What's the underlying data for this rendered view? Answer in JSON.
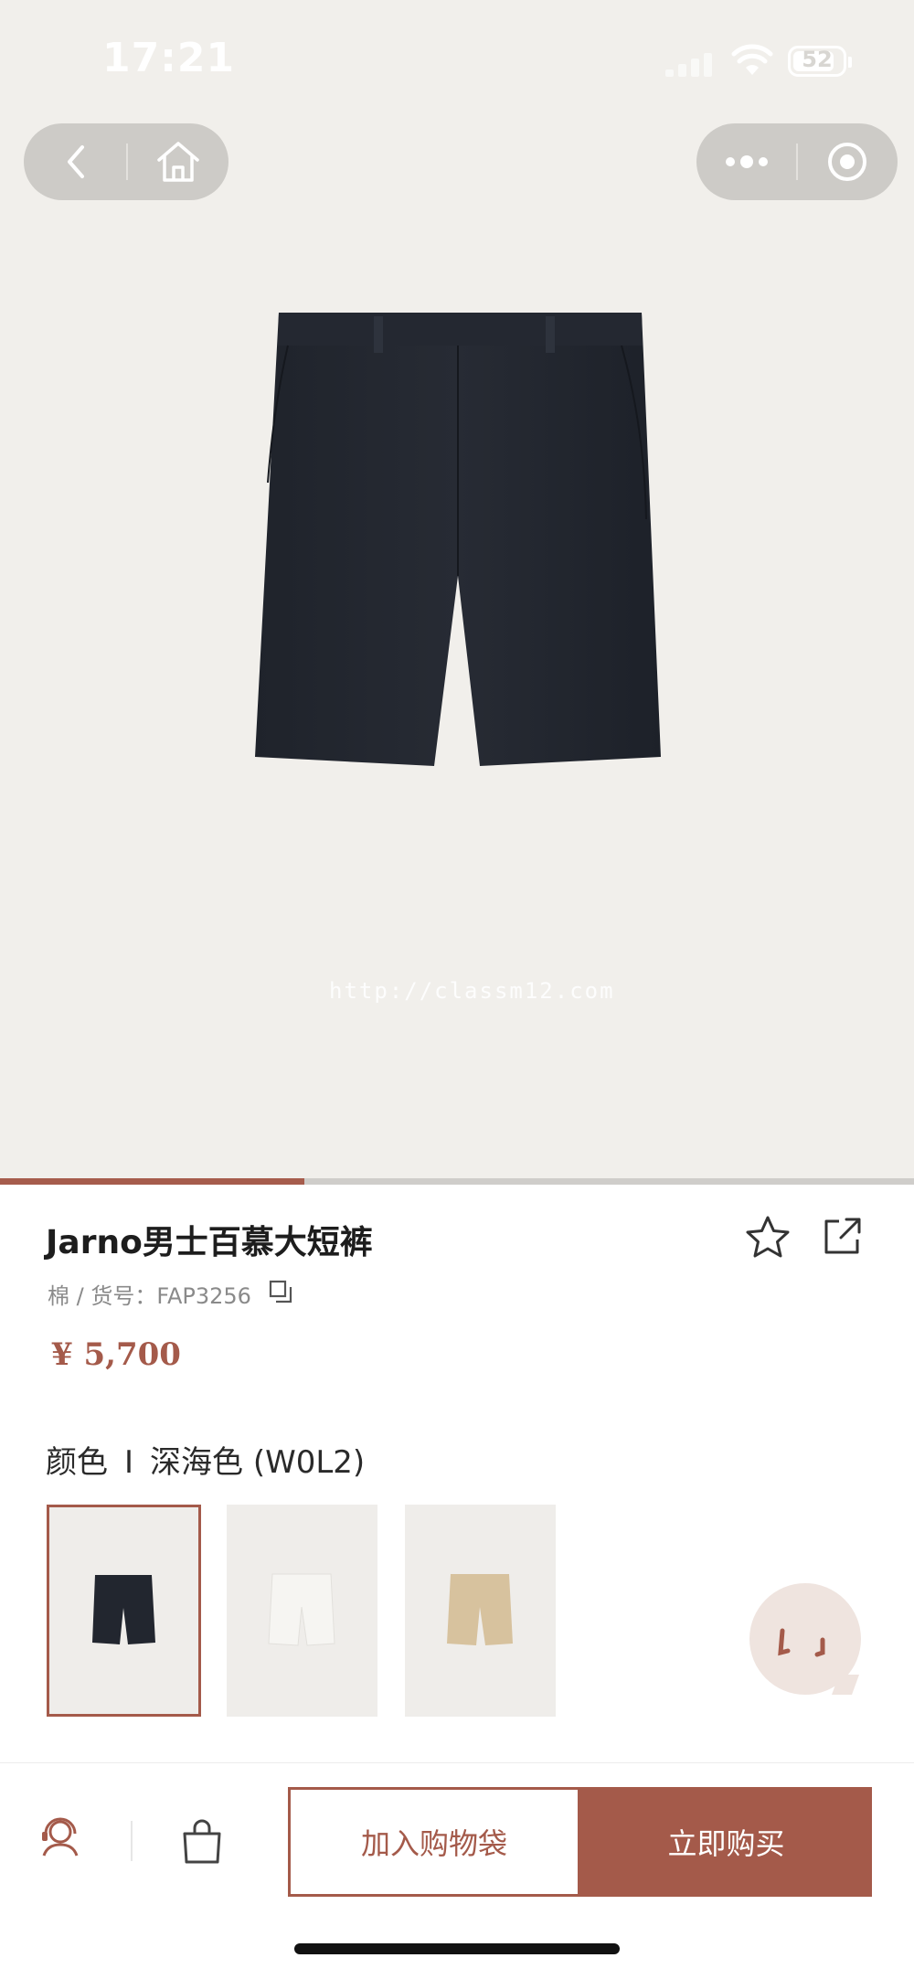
{
  "status_bar": {
    "time": "17:21",
    "battery_level": "52"
  },
  "nav": {
    "back_icon": "chevron-left-icon",
    "home_icon": "home-icon",
    "more_icon": "more-dots-icon",
    "close_icon": "mini-program-close-icon"
  },
  "hero": {
    "watermark": "http://classm12.com",
    "gallery_progress": 0.333
  },
  "product": {
    "title": "Jarno男士百慕大短裤",
    "subtitle": "棉 / 货号：FAP3256",
    "price": "¥ 5,700",
    "color_label": "颜色",
    "color_separator": "I",
    "color_value": "深海色 (W0L2)",
    "swatches": [
      {
        "name": "navy",
        "color": "#22262f",
        "selected": true
      },
      {
        "name": "white",
        "color": "#f6f5f2",
        "selected": false
      },
      {
        "name": "beige",
        "color": "#d7c29e",
        "selected": false
      }
    ]
  },
  "actions": {
    "add_to_bag": "加入购物袋",
    "buy_now": "立即购买"
  },
  "colors": {
    "accent": "#a45a4a",
    "hero_bg": "#f1efeb"
  }
}
